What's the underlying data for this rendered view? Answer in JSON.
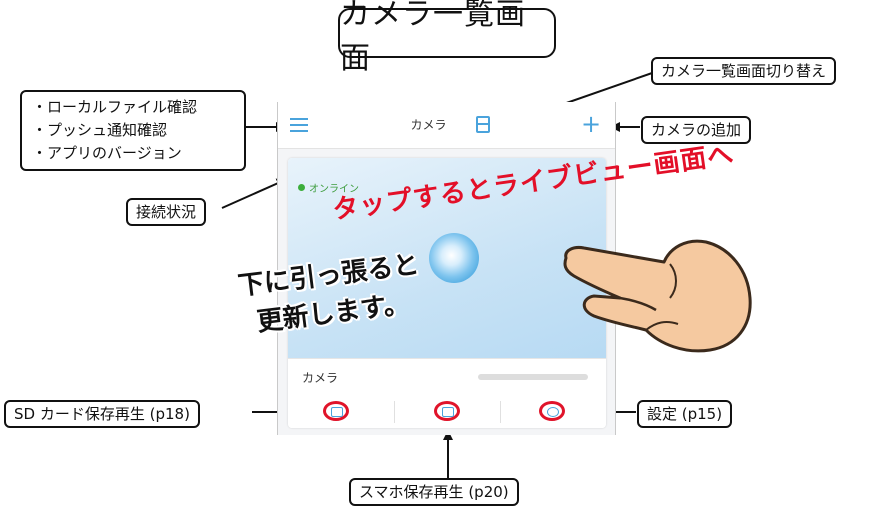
{
  "title": "カメラ一覧画面",
  "callouts": {
    "switch_view": "カメラ一覧画面切り替え",
    "menu_lines": [
      "・ローカルファイル確認",
      "・プッシュ通知確認",
      "・アプリのバージョン"
    ],
    "add_camera": "カメラの追加",
    "connection_status": "接続状況",
    "sd_playback": "SD カード保存再生 (p18)",
    "phone_playback": "スマホ保存再生 (p20)",
    "settings": "設定 (p15)"
  },
  "overlay": {
    "tap_text": "タップするとライブビュー画面へ",
    "pull_line1": "下に引っ張ると",
    "pull_line2": "更新します。"
  },
  "phone": {
    "header_title": "カメラ",
    "online_label": "オンライン",
    "camera_name": "カメラ"
  },
  "colors": {
    "accent_blue": "#4aa3dc",
    "highlight_red": "#e0142a",
    "online_green": "#3cae3c",
    "preview_blue": "#c7e2f5"
  },
  "icons": [
    "menu-icon",
    "view-switch-icon",
    "add-icon",
    "sd-card-icon",
    "phone-storage-icon",
    "settings-icon",
    "camera-lens-icon",
    "hand-icon"
  ]
}
